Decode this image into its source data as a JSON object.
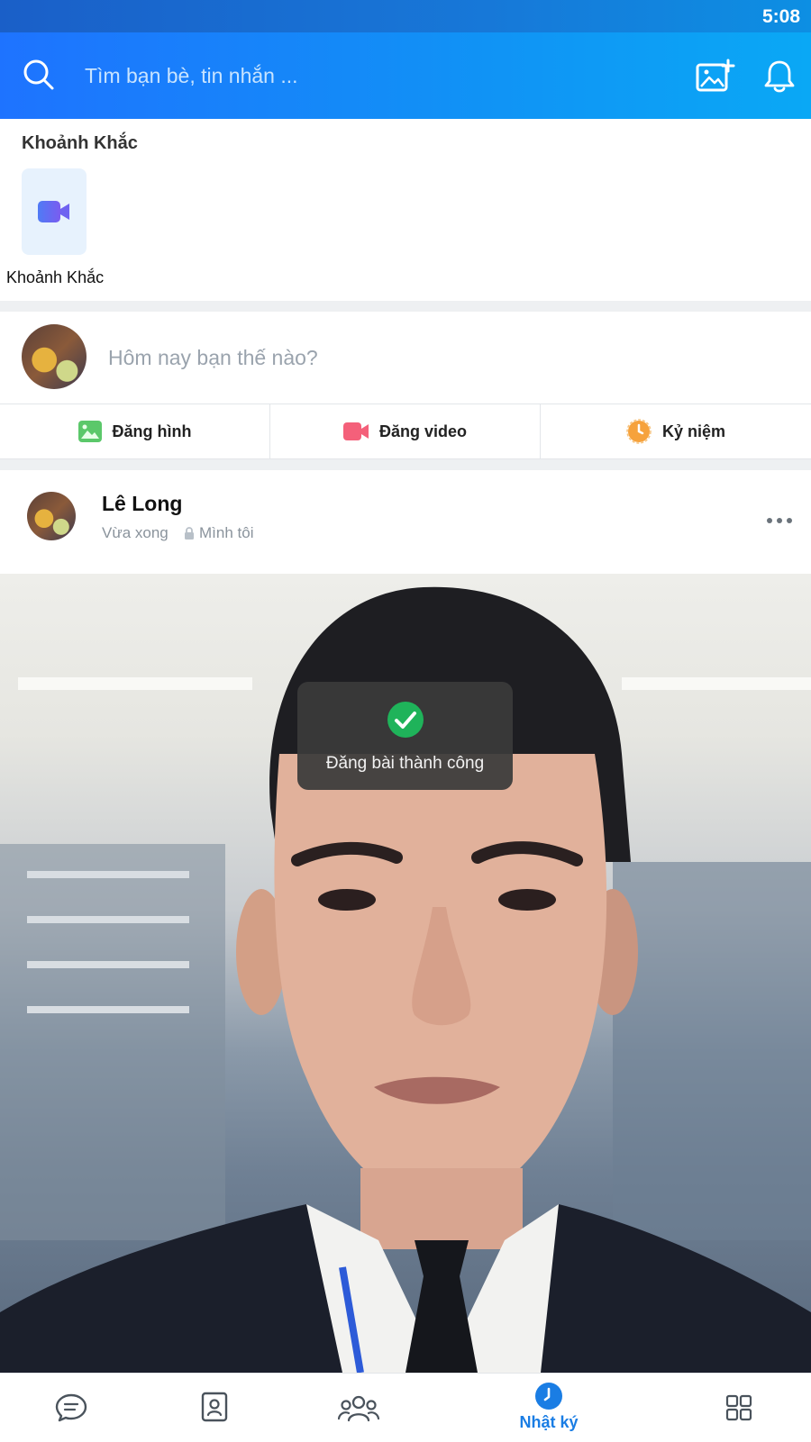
{
  "status_bar": {
    "time": "5:08"
  },
  "header": {
    "search_placeholder": "Tìm bạn bè, tin nhắn ...",
    "icons": [
      "search-icon",
      "add-photo-icon",
      "bell-icon"
    ]
  },
  "moments": {
    "title": "Khoảnh Khắc",
    "items": [
      {
        "label": "Khoảnh Khắc",
        "icon": "video-camera-icon"
      }
    ]
  },
  "composer": {
    "prompt": "Hôm nay bạn thế nào?",
    "actions": [
      {
        "label": "Đăng hình",
        "icon": "image-icon"
      },
      {
        "label": "Đăng video",
        "icon": "video-icon"
      },
      {
        "label": "Kỷ niệm",
        "icon": "memory-clock-icon"
      }
    ]
  },
  "post": {
    "author": "Lê Long",
    "time": "Vừa xong",
    "privacy": "Mình tôi",
    "privacy_icon": "lock-icon"
  },
  "toast": {
    "message": "Đăng bài thành công",
    "icon": "check-circle-icon"
  },
  "bottom_nav": {
    "active_label": "Nhật ký",
    "items": [
      "messages-icon",
      "contacts-icon",
      "groups-icon",
      "timeline-icon",
      "more-grid-icon"
    ]
  },
  "colors": {
    "header_start": "#1e73ff",
    "header_end": "#0aa8f5",
    "accent": "#1a7de4",
    "success": "#1fb35a"
  }
}
